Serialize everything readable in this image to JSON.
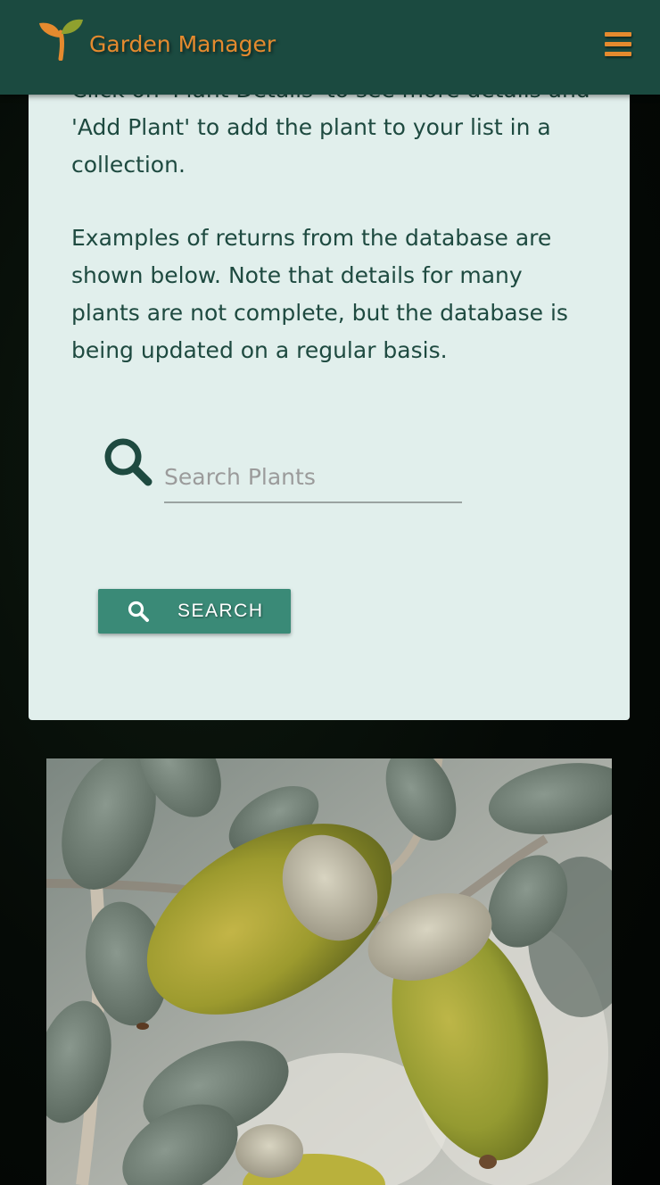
{
  "app": {
    "brand_name": "Garden Manager",
    "accent_color": "#e58a2e",
    "navbar_color": "#1b4a40",
    "menu_icon": "hamburger-menu-icon",
    "logo_icon": "sprout-logo-icon"
  },
  "intro": {
    "paragraph1": "Click on 'Plant Details' to see more details and 'Add Plant' to add the plant to your list in a collection.",
    "paragraph2": "Examples of returns from the database are shown below. Note that details for many plants are not complete, but the database is being updated on a regular basis."
  },
  "search": {
    "placeholder": "Search Plants",
    "value": "",
    "button_label": "SEARCH",
    "icon": "magnifier-icon",
    "button_color": "#3a8a77"
  },
  "example_image": {
    "description_icon": "acorn-photo"
  }
}
